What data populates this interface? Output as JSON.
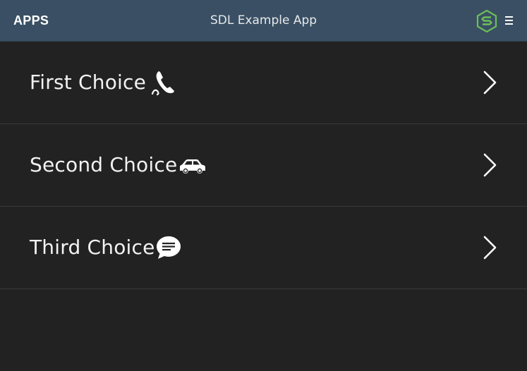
{
  "header": {
    "apps_label": "APPS",
    "title": "SDL Example App",
    "logo_icon": "sdl-logo-icon",
    "menu_icon": "hamburger-menu-icon",
    "bar_color": "#3a4f63",
    "logo_color": "#6bbf59"
  },
  "choices": [
    {
      "label": "First Choice",
      "icon": "phone-icon"
    },
    {
      "label": "Second Choice",
      "icon": "car-icon"
    },
    {
      "label": "Third Choice",
      "icon": "chat-bubble-icon"
    }
  ],
  "theme": {
    "background": "#222222",
    "text": "#f2f2f2",
    "divider": "#3a3a3a"
  }
}
